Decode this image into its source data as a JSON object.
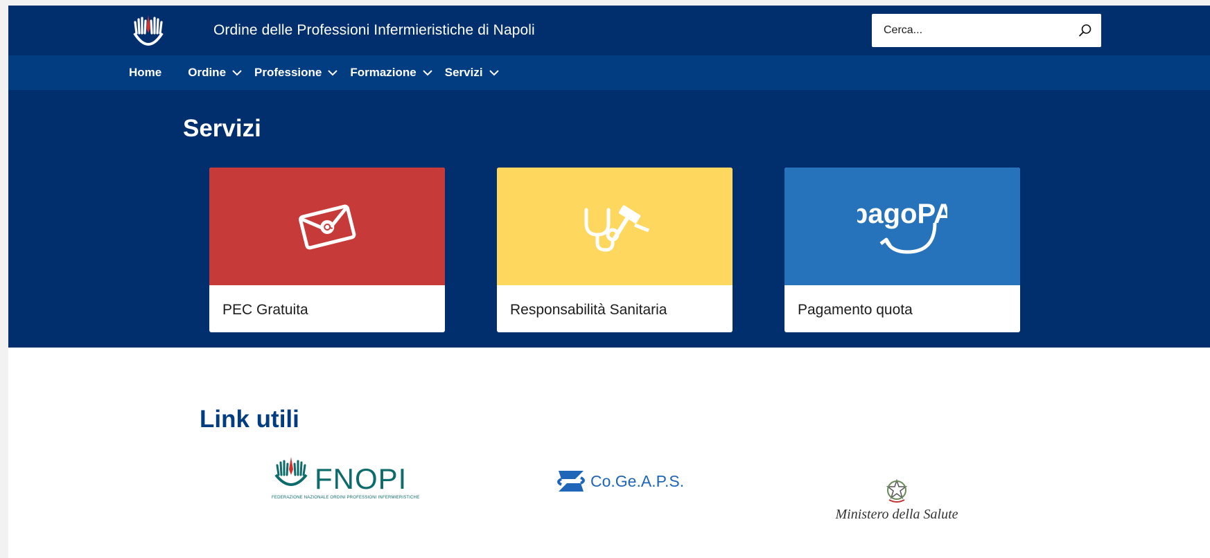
{
  "header": {
    "site_title": "Ordine delle Professioni Infermieristiche di Napoli",
    "logo_icon": "opi-hands-logo-icon",
    "search": {
      "placeholder": "Cerca...",
      "icon": "search-icon"
    }
  },
  "nav": {
    "items": [
      {
        "label": "Home",
        "has_dropdown": false
      },
      {
        "label": "Ordine",
        "has_dropdown": true
      },
      {
        "label": "Professione",
        "has_dropdown": true
      },
      {
        "label": "Formazione",
        "has_dropdown": true
      },
      {
        "label": "Servizi",
        "has_dropdown": true
      }
    ]
  },
  "servizi": {
    "title": "Servizi",
    "cards": [
      {
        "label": "PEC Gratuita",
        "icon": "email-at-icon",
        "color": "#c63b3a"
      },
      {
        "label": "Responsabilità Sanitaria",
        "icon": "stethoscope-gavel-icon",
        "color": "#fed75e"
      },
      {
        "label": "Pagamento quota",
        "icon": "pagopa-logo-icon",
        "logo_text": "pagoPA",
        "color": "#2673bb"
      }
    ]
  },
  "links": {
    "title": "Link utili",
    "items": [
      {
        "name": "FNOPI",
        "logo_text": "FNOPI",
        "subtitle": "FEDERAZIONE NAZIONALE ORDINI PROFESSIONI INFERMIERISTICHE"
      },
      {
        "name": "Co.Ge.A.P.S.",
        "logo_text": "Co.Ge.A.P.S."
      },
      {
        "name": "Ministero della Salute",
        "logo_text": "Ministero della Salute"
      }
    ]
  },
  "colors": {
    "header_bg": "#012f6e",
    "nav_bg": "#023d82",
    "links_title": "#023d82"
  }
}
